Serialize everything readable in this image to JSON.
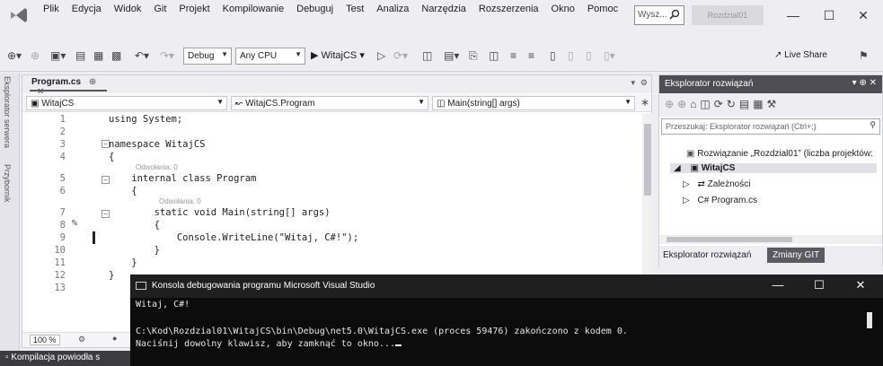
{
  "menubar": {
    "items": [
      "Plik",
      "Edycja",
      "Widok",
      "Git",
      "Projekt",
      "Kompilowanie",
      "Debuguj",
      "Test",
      "Analiza",
      "Narzędzia",
      "Rozszerzenia",
      "Okno",
      "Pomoc"
    ],
    "search_placeholder": "Wysz...",
    "solution_name": "Rozdzial01"
  },
  "toolbar": {
    "configuration": "Debug",
    "platform": "Any CPU",
    "run_label": "WitajCS",
    "live_share": "Live Share"
  },
  "side_panels": [
    "Eksplorator serwera",
    "Przybornik"
  ],
  "editor": {
    "tab_label": "Program.cs",
    "nav_project": "WitajCS",
    "nav_class": "WitajCS.Program",
    "nav_member": "Main(string[] args)",
    "references_label": "Odwołania: 0",
    "zoom": "100 %",
    "code_lines": [
      {
        "num": "1",
        "text": "using System;"
      },
      {
        "num": "2",
        "text": ""
      },
      {
        "num": "3",
        "text": "namespace WitajCS"
      },
      {
        "num": "4",
        "text": "{"
      },
      {
        "num": "5",
        "text": "    internal class Program"
      },
      {
        "num": "6",
        "text": "    {"
      },
      {
        "num": "7",
        "text": "        static void Main(string[] args)"
      },
      {
        "num": "8",
        "text": "        {"
      },
      {
        "num": "9",
        "text": "            Console.WriteLine(\"Witaj, C#!\");"
      },
      {
        "num": "10",
        "text": "        }"
      },
      {
        "num": "11",
        "text": "    }"
      },
      {
        "num": "12",
        "text": "}"
      },
      {
        "num": "13",
        "text": ""
      }
    ]
  },
  "solution_explorer": {
    "title": "Eksplorator rozwiązań",
    "search_placeholder": "Przeszukaj: Eksplorator rozwiązań (Ctrl+;)",
    "solution_node": "Rozwiązanie „Rozdzial01” (liczba projektów:",
    "project_node": "WitajCS",
    "dependencies_node": "Zależności",
    "file_node": "Program.cs",
    "tab_active": "Eksplorator rozwiązań",
    "tab_git": "Zmiany GIT"
  },
  "console": {
    "title": "Konsola debugowania programu Microsoft Visual Studio",
    "lines": [
      "Witaj, C#!",
      "",
      "C:\\Kod\\Rozdzial01\\WitajCS\\bin\\Debug\\net5.0\\WitajCS.exe (proces 59476) zakończono z kodem 0.",
      "Naciśnij dowolny klawisz, aby zamknąć to okno..."
    ]
  },
  "statusbar": {
    "text": "Kompilacja powiodła s"
  }
}
